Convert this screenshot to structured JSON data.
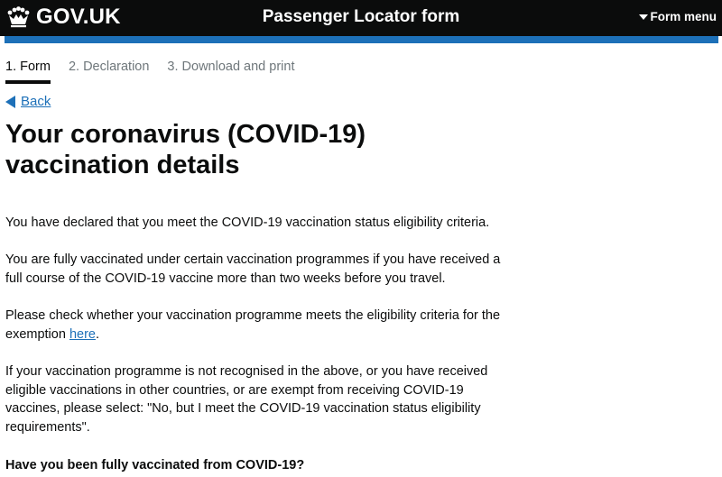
{
  "header": {
    "logo_text": "GOV.UK",
    "service_name": "Passenger Locator form",
    "menu_label": "Form menu"
  },
  "steps": [
    {
      "label": "1. Form"
    },
    {
      "label": "2. Declaration"
    },
    {
      "label": "3. Download and print"
    }
  ],
  "back_label": "Back",
  "title": "Your coronavirus (COVID-19) vaccination details",
  "paragraphs": {
    "p1": "You have declared that you meet the COVID-19 vaccination status eligibility criteria.",
    "p2": "You are fully vaccinated under certain vaccination programmes if you have received a full course of the COVID-19 vaccine more than two weeks before you travel.",
    "p3_before": "Please check whether your vaccination programme meets the eligibility criteria for the exemption ",
    "p3_link": "here",
    "p3_after": ".",
    "p4": "If your vaccination programme is not recognised in the above, or you have received eligible vaccinations in other countries, or are exempt from receiving COVID-19 vaccines, please select: \"No, but I meet the COVID-19 vaccination status eligibility requirements\"."
  },
  "question": "Have you been fully vaccinated from COVID-19?",
  "icons": {
    "crown": "crown-icon",
    "menu_caret": "caret-down-icon",
    "back_arrow": "back-triangle-icon"
  },
  "colors": {
    "header_bg": "#0b0c0c",
    "accent_blue": "#1d70b8",
    "text": "#0b0c0c",
    "inactive_step": "#6f777b"
  }
}
